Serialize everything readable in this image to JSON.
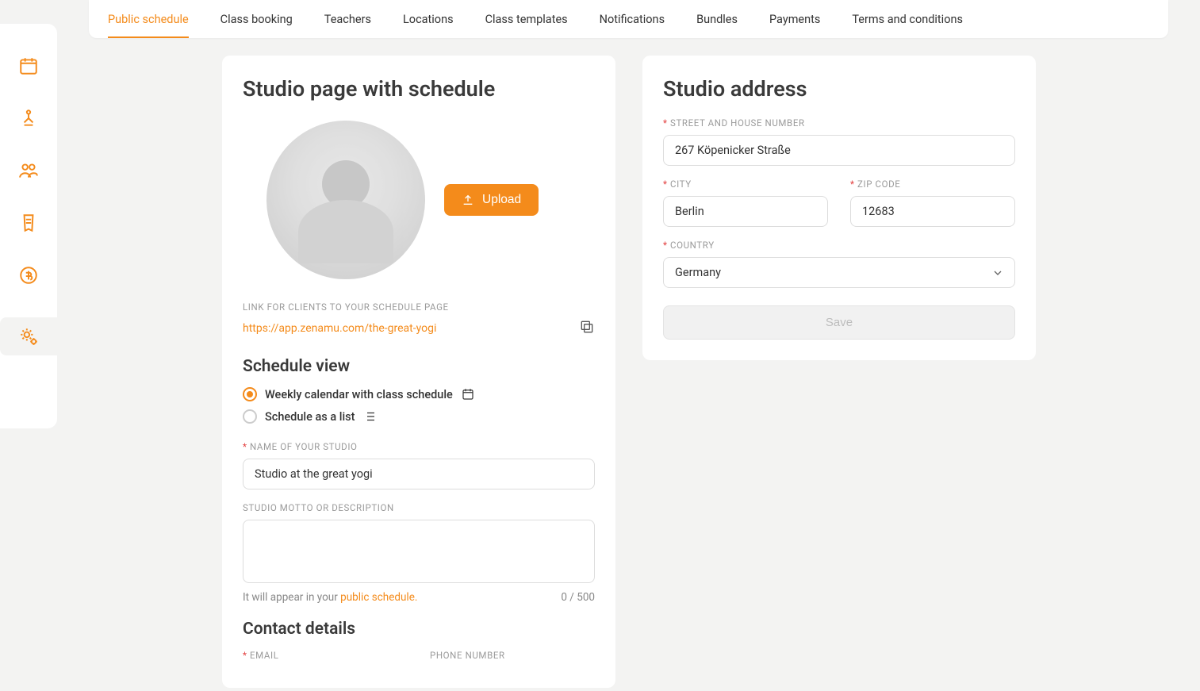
{
  "tabs": [
    "Public schedule",
    "Class booking",
    "Teachers",
    "Locations",
    "Class templates",
    "Notifications",
    "Bundles",
    "Payments",
    "Terms and conditions"
  ],
  "activeTab": 0,
  "leftCard": {
    "title": "Studio page with schedule",
    "uploadLabel": "Upload",
    "linkLabel": "LINK FOR CLIENTS TO YOUR SCHEDULE PAGE",
    "linkValue": "https://app.zenamu.com/the-great-yogi",
    "scheduleViewHeading": "Schedule view",
    "radioWeekly": "Weekly calendar with class schedule",
    "radioList": "Schedule as a list",
    "nameLabel": "NAME OF YOUR STUDIO",
    "nameValue": "Studio at the great yogi",
    "mottoLabel": "STUDIO MOTTO OR DESCRIPTION",
    "mottoValue": "",
    "helperPrefix": "It will appear in your ",
    "helperLink": "public schedule.",
    "charCount": "0 / 500",
    "contactHeading": "Contact details",
    "emailLabel": "EMAIL",
    "phoneLabel": "PHONE NUMBER"
  },
  "rightCard": {
    "title": "Studio address",
    "streetLabel": "STREET AND HOUSE NUMBER",
    "streetValue": "267 Köpenicker Straße",
    "cityLabel": "CITY",
    "cityValue": "Berlin",
    "zipLabel": "ZIP CODE",
    "zipValue": "12683",
    "countryLabel": "COUNTRY",
    "countryValue": "Germany",
    "saveLabel": "Save"
  }
}
